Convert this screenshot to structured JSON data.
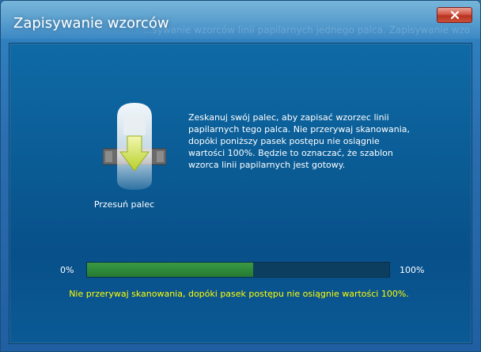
{
  "window": {
    "title": "Zapisywanie wzorców",
    "ghost_text": "...sywanie wzorców linii papilarnych jednego palca. Zapisywanie wzo",
    "close_icon": "close-icon"
  },
  "left_panel": {
    "icon": "finger-swipe-icon",
    "caption": "Przesuń palec"
  },
  "instruction": "Zeskanuj swój palec, aby zapisać wzorzec linii papilarnych tego palca.  Nie przerywaj skanowania, dopóki poniższy pasek postępu nie osiągnie wartości 100%.  Będzie to oznaczać, że szablon wzorca linii papilarnych jest gotowy.",
  "progress": {
    "min_label": "0%",
    "max_label": "100%",
    "value_fraction": 0.55,
    "fill_color": "#2e8a3a"
  },
  "warning": "Nie przerywaj skanowania, dopóki pasek postępu nie osiągnie wartości 100%.",
  "colors": {
    "warning_text": "#ffff00",
    "background": "#0a5a93"
  }
}
